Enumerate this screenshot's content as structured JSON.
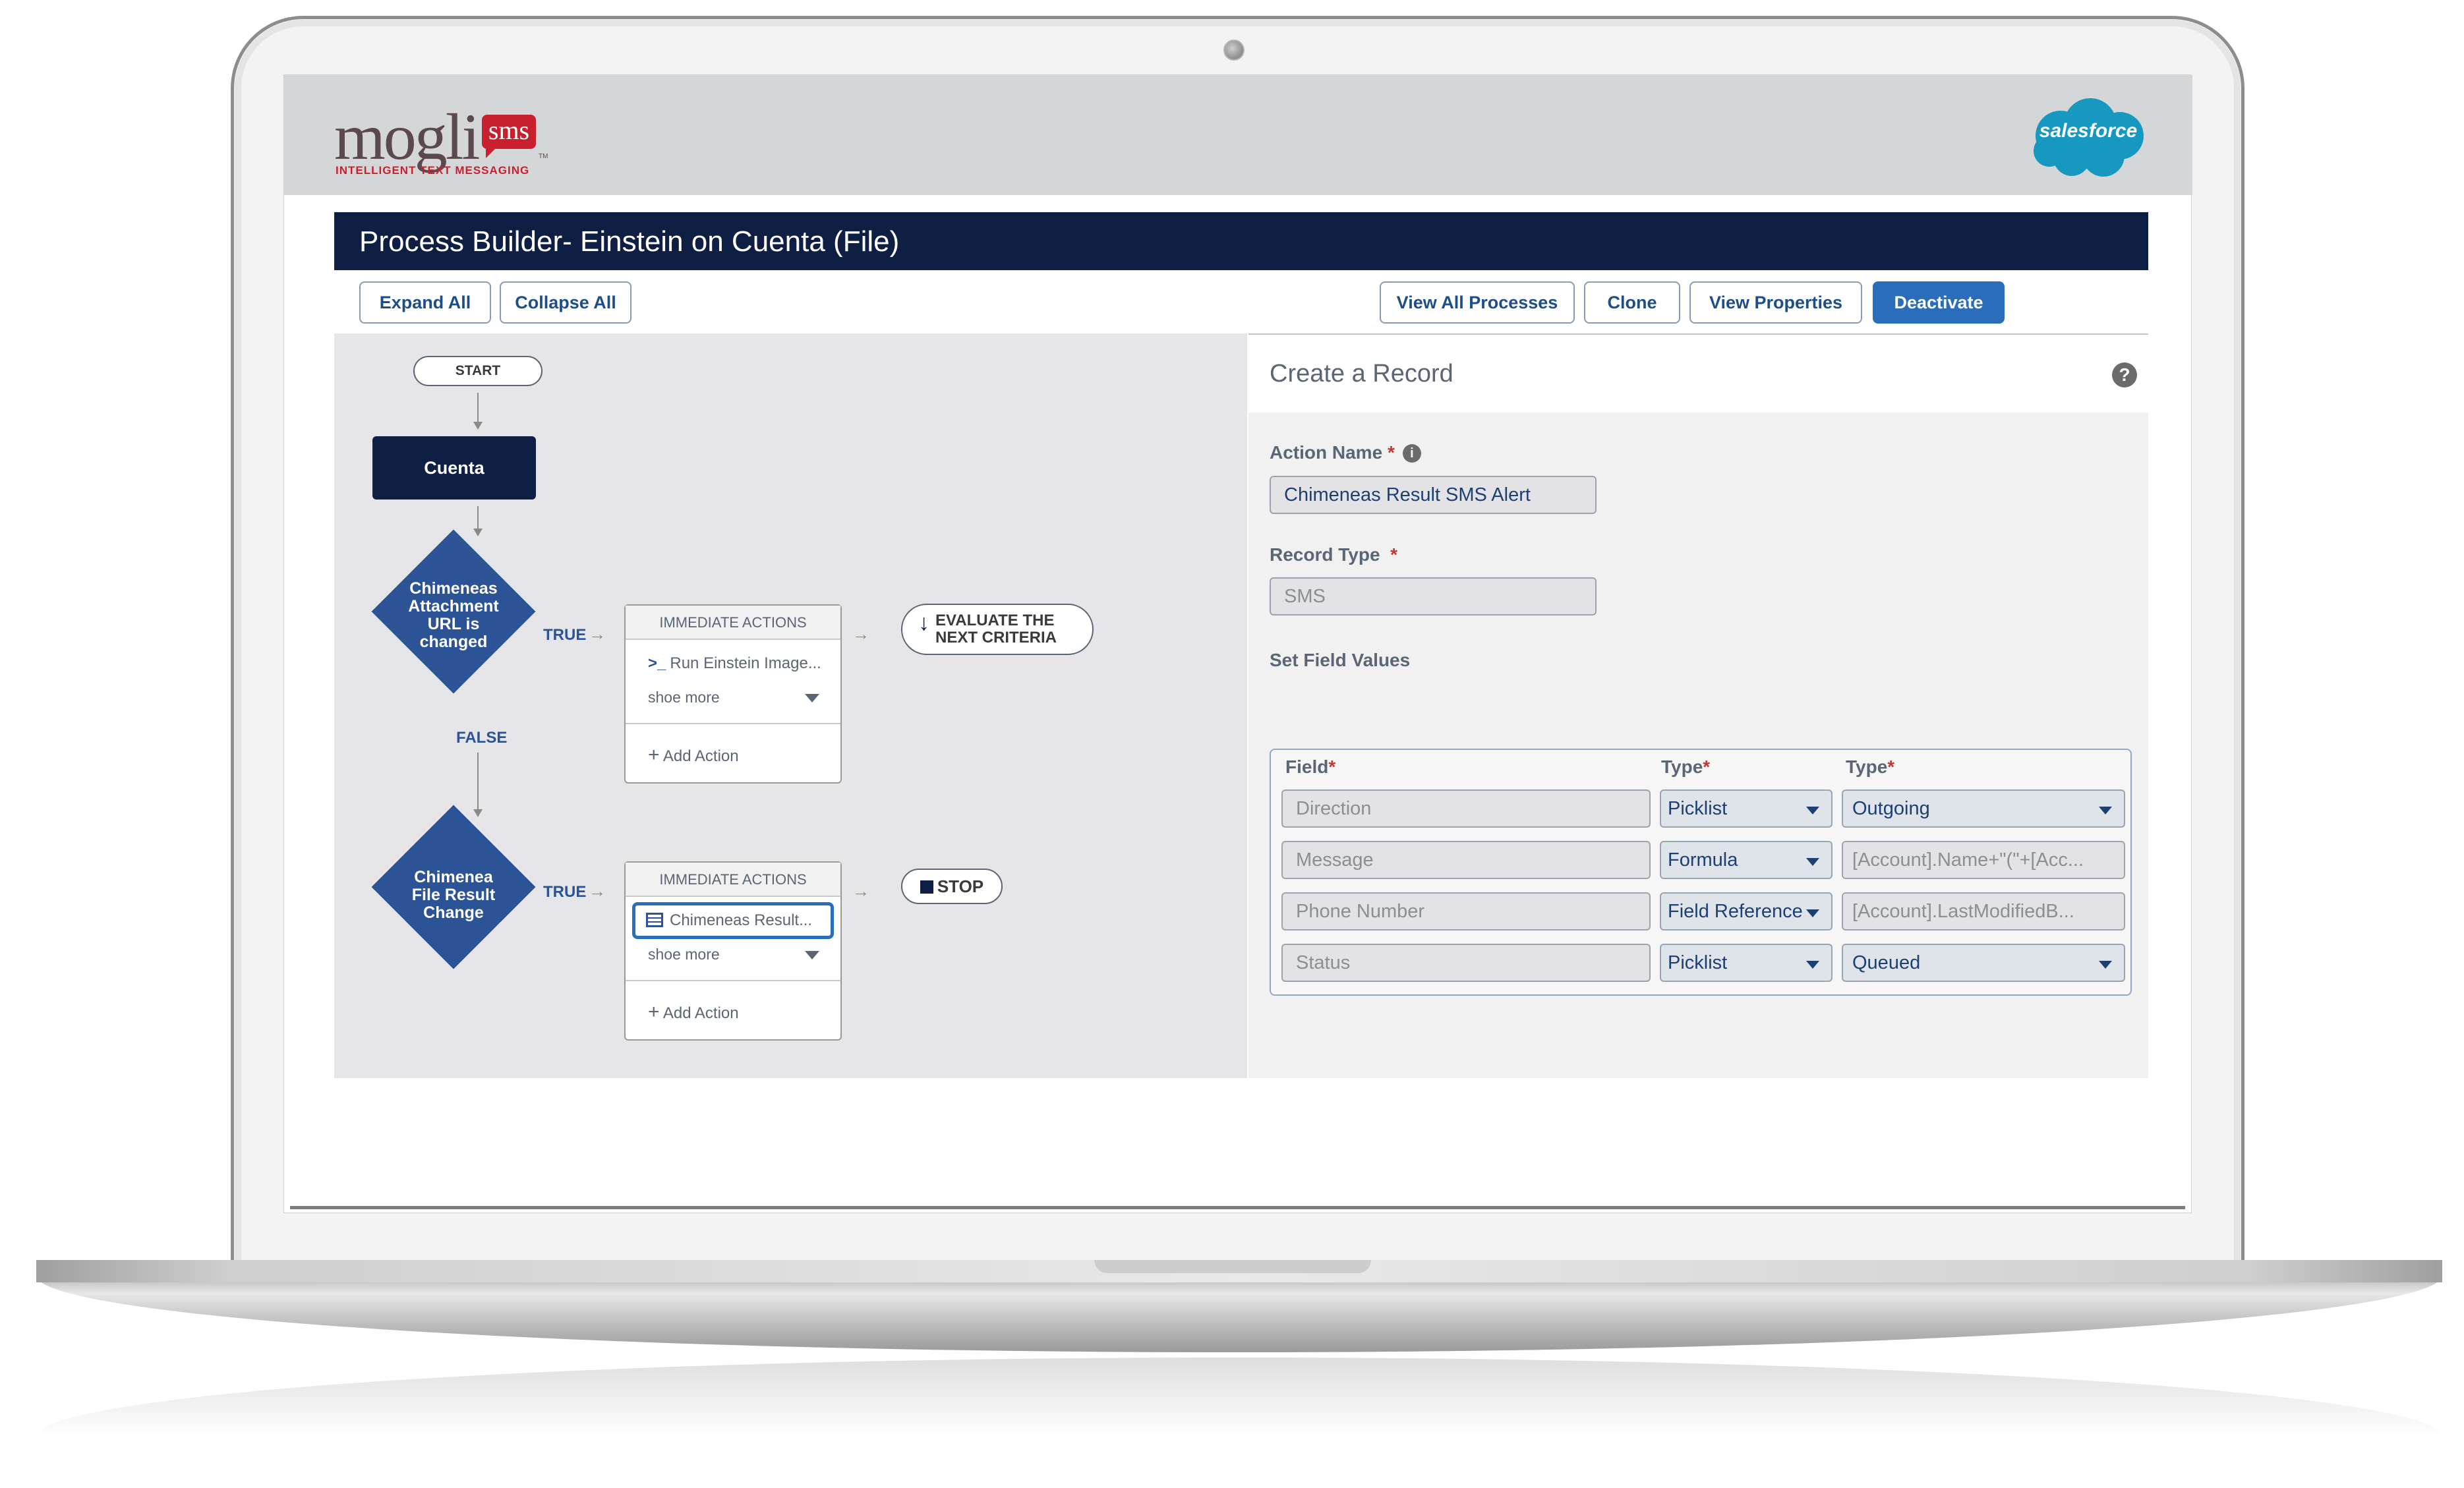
{
  "brand": {
    "logo_word": "mogli",
    "logo_badge": "sms",
    "logo_tagline": "INTELLIGENT TEXT MESSAGING",
    "logo_tm": "TM",
    "partner": "salesforce"
  },
  "page_title": "Process Builder- Einstein on Cuenta (File)",
  "toolbar": {
    "expand_all": "Expand All",
    "collapse_all": "Collapse  All",
    "view_all_processes": "View  All Processes",
    "clone": "Clone",
    "view_properties": "View Properties",
    "deactivate": "Deactivate"
  },
  "flow": {
    "start": "START",
    "object_node": "Cuenta",
    "criteria1": "Chimeneas Attachment URL is changed",
    "criteria2": "Chimenea File Result Change",
    "true_label": "TRUE",
    "false_label": "FALSE",
    "immediate_actions": "IMMEDIATE ACTIONS",
    "action1": "Run Einstein Image...",
    "action1_prefix": ">_",
    "action2": "Chimeneas Result...",
    "show_more": "shoe more",
    "add_action": "Add Action",
    "evaluate_next_line1": "EVALUATE THE",
    "evaluate_next_line2": "NEXT CRITERIA",
    "stop": "STOP"
  },
  "panel": {
    "title": "Create a Record",
    "action_name_label": "Action Name",
    "action_name_value": "Chimeneas Result SMS Alert",
    "record_type_label": "Record Type",
    "record_type_value": "SMS",
    "set_field_values_label": "Set Field Values",
    "col_field": "Field",
    "col_type": "Type",
    "col_type2": "Type",
    "rows": [
      {
        "field": "Direction",
        "type": "Picklist",
        "value": "Outgoing"
      },
      {
        "field": "Message",
        "type": "Formula",
        "value": "[Account].Name+\"(\"+[Acc..."
      },
      {
        "field": "Phone Number",
        "type": "Field Reference",
        "value": "[Account].LastModifiedB..."
      },
      {
        "field": "Status",
        "type": "Picklist",
        "value": "Queued"
      }
    ]
  },
  "colors": {
    "navy": "#0f1f44",
    "diamond": "#2b5395",
    "accent": "#2a6dbb",
    "required": "#c23934",
    "brand_red": "#c8202f",
    "salesforce_blue": "#1798c1"
  },
  "icons": [
    "camera-icon",
    "help-icon",
    "info-icon",
    "arrow-down-icon",
    "stop-icon",
    "record-icon",
    "plus-icon",
    "chevron-down-icon"
  ]
}
